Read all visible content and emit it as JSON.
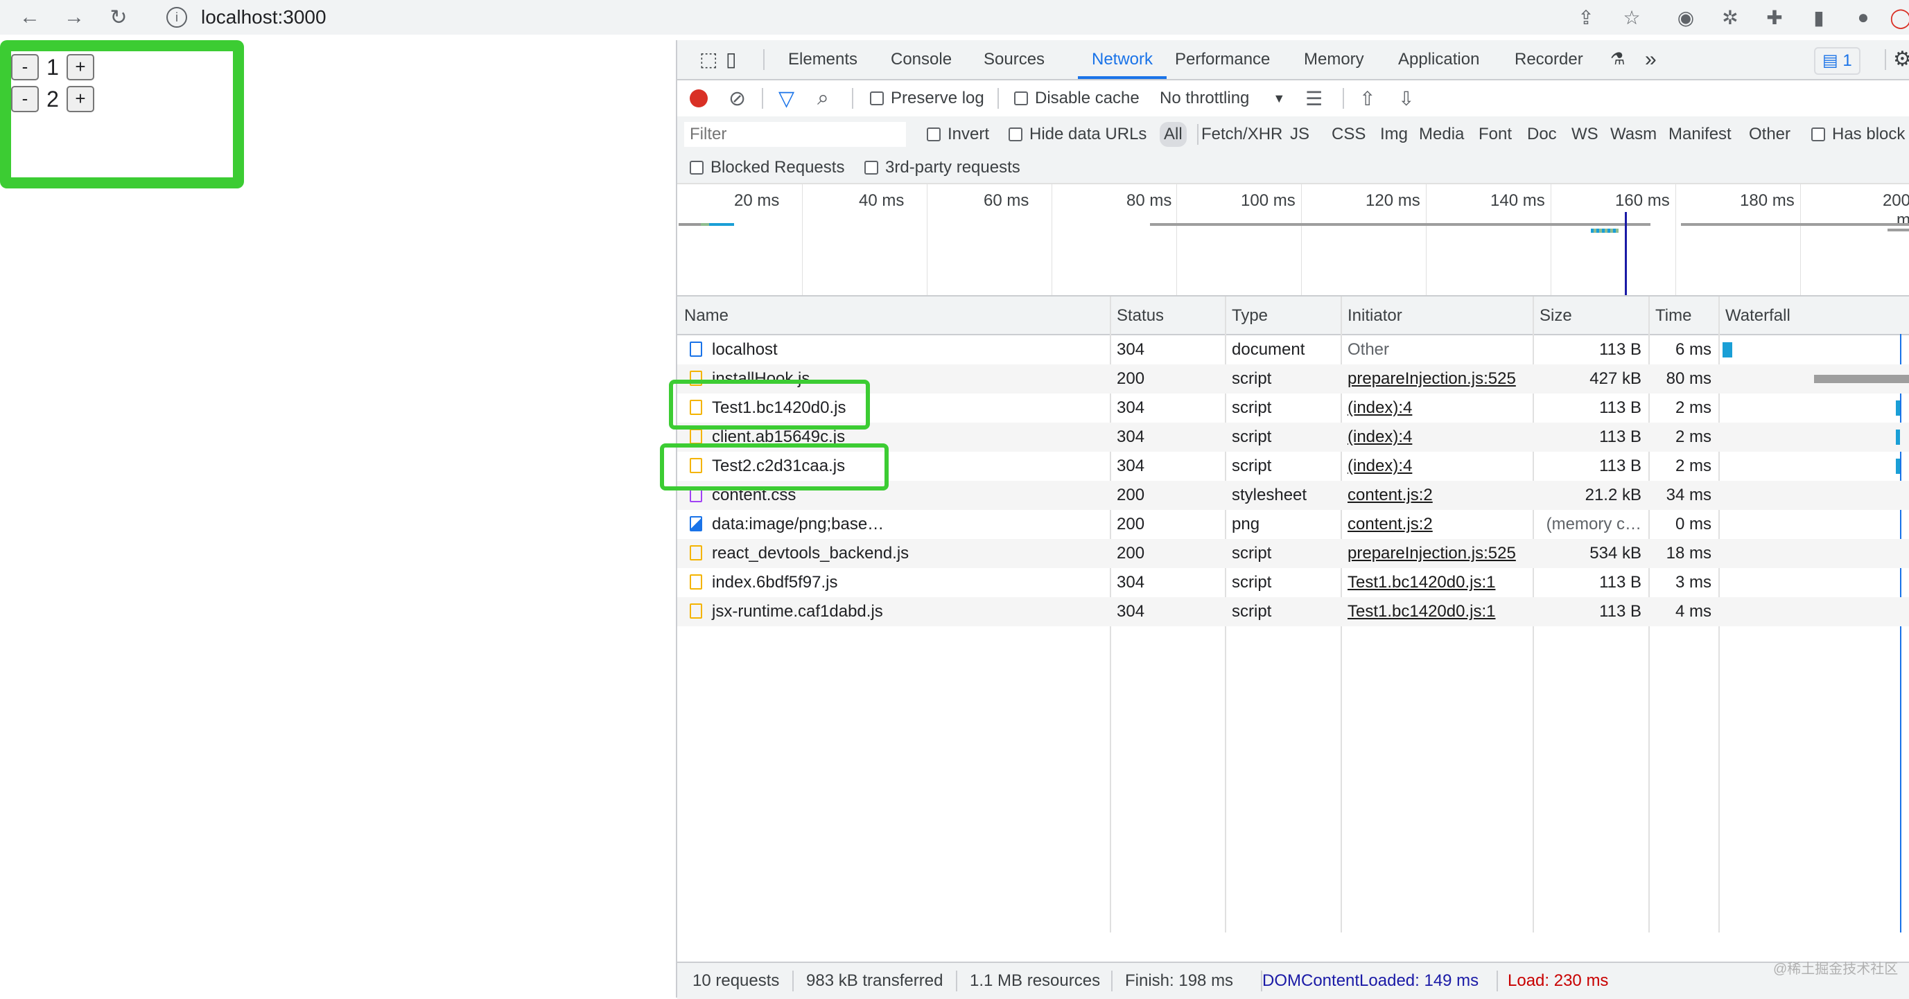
{
  "browser": {
    "url": "localhost:3000",
    "nav": {
      "back": "←",
      "forward": "→",
      "reload": "↻"
    }
  },
  "page": {
    "counters": [
      {
        "minus": "-",
        "value": "1",
        "plus": "+"
      },
      {
        "minus": "-",
        "value": "2",
        "plus": "+"
      }
    ]
  },
  "devtools": {
    "tabs": [
      "Elements",
      "Console",
      "Sources",
      "Network",
      "Performance",
      "Memory",
      "Application",
      "Recorder"
    ],
    "active_tab": "Network",
    "more_tabs": "»",
    "issues_count": "1",
    "toolbar": {
      "preserve_log": "Preserve log",
      "disable_cache": "Disable cache",
      "throttling": "No throttling"
    },
    "filter": {
      "placeholder": "Filter",
      "invert": "Invert",
      "hide_data_urls": "Hide data URLs",
      "types": [
        "All",
        "Fetch/XHR",
        "JS",
        "CSS",
        "Img",
        "Media",
        "Font",
        "Doc",
        "WS",
        "Wasm",
        "Manifest",
        "Other"
      ],
      "has_blocked": "Has block",
      "blocked_requests": "Blocked Requests",
      "third_party": "3rd-party requests"
    },
    "overview_ticks": [
      "20 ms",
      "40 ms",
      "60 ms",
      "80 ms",
      "100 ms",
      "120 ms",
      "140 ms",
      "160 ms",
      "180 ms",
      "200 m"
    ],
    "columns": [
      "Name",
      "Status",
      "Type",
      "Initiator",
      "Size",
      "Time",
      "Waterfall"
    ],
    "rows": [
      {
        "name": "localhost",
        "status": "304",
        "type": "document",
        "initiator": "Other",
        "size": "113 B",
        "time": "6 ms",
        "icon": "document-icon"
      },
      {
        "name": "installHook.js",
        "status": "200",
        "type": "script",
        "initiator": "prepareInjection.js:525",
        "size": "427 kB",
        "time": "80 ms",
        "icon": "script-icon"
      },
      {
        "name": "Test1.bc1420d0.js",
        "status": "304",
        "type": "script",
        "initiator": "(index):4",
        "size": "113 B",
        "time": "2 ms",
        "icon": "script-icon"
      },
      {
        "name": "client.ab15649c.js",
        "status": "304",
        "type": "script",
        "initiator": "(index):4",
        "size": "113 B",
        "time": "2 ms",
        "icon": "script-icon"
      },
      {
        "name": "Test2.c2d31caa.js",
        "status": "304",
        "type": "script",
        "initiator": "(index):4",
        "size": "113 B",
        "time": "2 ms",
        "icon": "script-icon"
      },
      {
        "name": "content.css",
        "status": "200",
        "type": "stylesheet",
        "initiator": "content.js:2",
        "size": "21.2 kB",
        "time": "34 ms",
        "icon": "stylesheet-icon"
      },
      {
        "name": "data:image/png;base…",
        "status": "200",
        "type": "png",
        "initiator": "content.js:2",
        "size": "(memory c…",
        "time": "0 ms",
        "icon": "image-icon"
      },
      {
        "name": "react_devtools_backend.js",
        "status": "200",
        "type": "script",
        "initiator": "prepareInjection.js:525",
        "size": "534 kB",
        "time": "18 ms",
        "icon": "script-icon"
      },
      {
        "name": "index.6bdf5f97.js",
        "status": "304",
        "type": "script",
        "initiator": "Test1.bc1420d0.js:1",
        "size": "113 B",
        "time": "3 ms",
        "icon": "script-icon"
      },
      {
        "name": "jsx-runtime.caf1dabd.js",
        "status": "304",
        "type": "script",
        "initiator": "Test1.bc1420d0.js:1",
        "size": "113 B",
        "time": "4 ms",
        "icon": "script-icon"
      }
    ],
    "status_bar": {
      "requests": "10 requests",
      "transferred": "983 kB transferred",
      "resources": "1.1 MB resources",
      "finish": "Finish: 198 ms",
      "dom_content_loaded": "DOMContentLoaded: 149 ms",
      "load": "Load: 230 ms"
    },
    "colors": {
      "accent": "#1a73e8",
      "highlight": "#3ccc33",
      "record": "#d93025",
      "dcl": "#1a1aa6",
      "load": "#c80000"
    }
  },
  "watermark": "@稀土掘金技术社区"
}
